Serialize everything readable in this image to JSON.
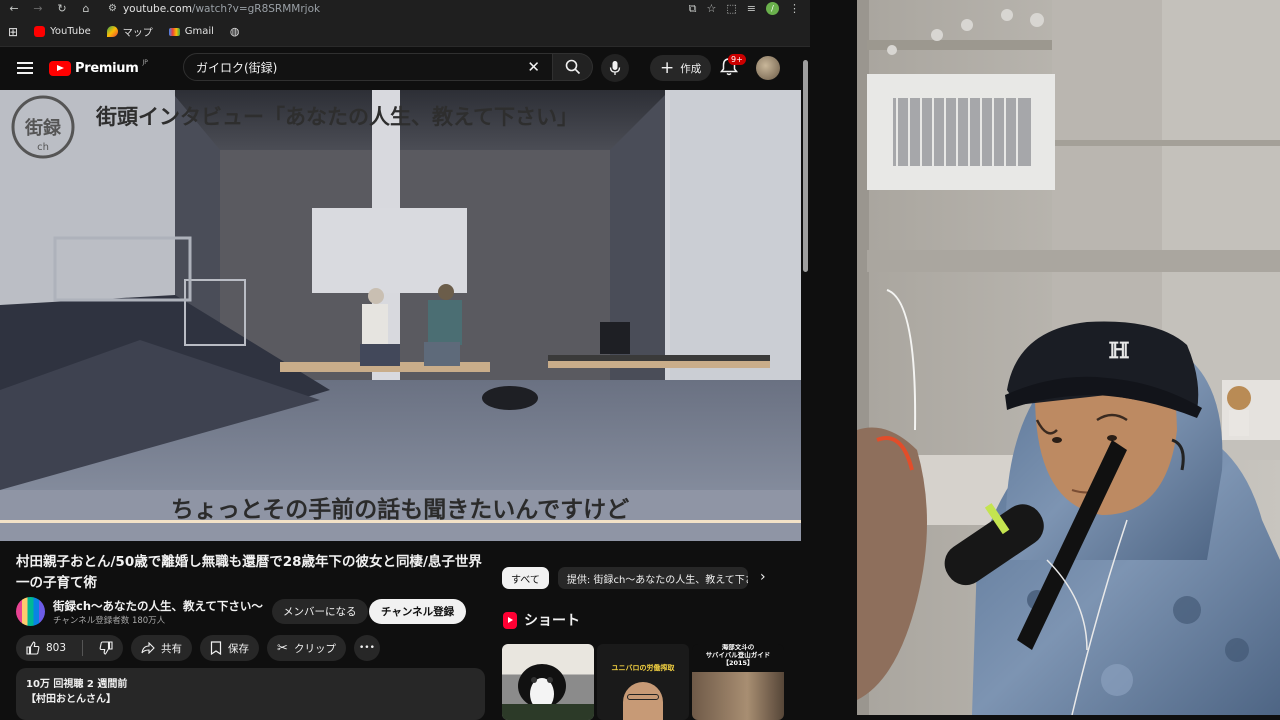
{
  "browser": {
    "url_host": "youtube.com",
    "url_path": "/watch?v=gR8SRMMrjok",
    "bookmarks": [
      {
        "label": "YouTube"
      },
      {
        "label": "マップ"
      },
      {
        "label": "Gmail"
      }
    ]
  },
  "youtube": {
    "logo_text": "Premium",
    "logo_sup": "JP",
    "search_value": "ガイロク(街録)",
    "create_label": "作成",
    "notif_badge": "9+"
  },
  "video": {
    "overlay_channel": "街録",
    "overlay_channel_sub": "ch",
    "overlay_heading": "街頭インタビュー「あなたの人生、教えて下さい」",
    "subtitle": "ちょっとその手前の話も聞きたいんですけど"
  },
  "watch": {
    "title": "村田親子おとん/50歳で離婚し無職も還暦で28歳年下の彼女と同棲/息子世界一の子育て術",
    "channel_name": "街録ch～あなたの人生、教えて下さい～",
    "channel_subs": "チャンネル登録者数 180万人",
    "member_label": "メンバーになる",
    "subscribe_label": "チャンネル登録",
    "like_count": "803",
    "share_label": "共有",
    "save_label": "保存",
    "clip_label": "クリップ",
    "more_label": "•••",
    "desc_meta": "10万 回視聴  2 週間前",
    "desc_line": "【村田おとんさん】"
  },
  "sidebar": {
    "chip_all": "すべて",
    "chip_provider": "提供: 街録ch～あなたの人生、教えて下さい～",
    "shorts_title": "ショート",
    "shorts": [
      {
        "caption": ""
      },
      {
        "caption": "ユニバロの労働搾取"
      },
      {
        "caption": "海部文斗の\nサバイバル登山ガイド\n【2015】"
      }
    ]
  },
  "colors": {
    "bg": "#0f0f0f",
    "brand_red": "#ff0000",
    "chip_bg": "#272727",
    "subtitle_text": "#2b2b2b"
  }
}
